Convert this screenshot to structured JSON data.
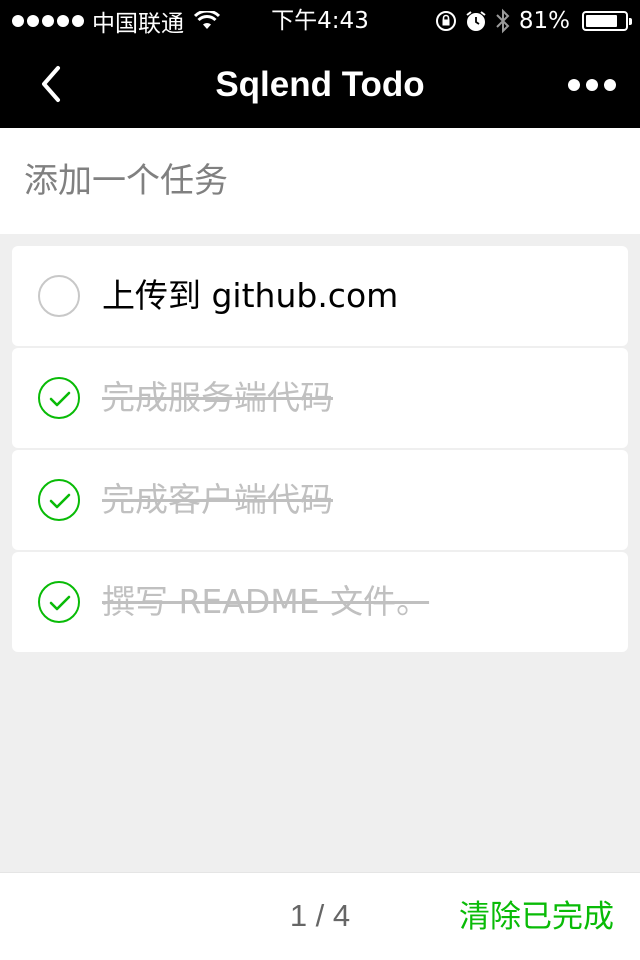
{
  "status_bar": {
    "carrier": "中国联通",
    "time": "下午4:43",
    "battery": "81%",
    "battery_level": 0.81,
    "icons": [
      "signal-dots-icon",
      "wifi-icon",
      "rotation-lock-icon",
      "alarm-icon",
      "bluetooth-icon",
      "battery-icon"
    ]
  },
  "nav": {
    "title": "Sqlend Todo",
    "back_icon": "chevron-left-icon",
    "more_icon": "more-dots-icon"
  },
  "add_task": {
    "placeholder": "添加一个任务",
    "value": ""
  },
  "todos": [
    {
      "text": "上传到 github.com",
      "completed": false
    },
    {
      "text": "完成服务端代码",
      "completed": true
    },
    {
      "text": "完成客户端代码",
      "completed": true
    },
    {
      "text": "撰写 README 文件。",
      "completed": true
    }
  ],
  "footer": {
    "counter": "1 / 4",
    "clear_label": "清除已完成"
  },
  "colors": {
    "accent_green": "#09bb07",
    "bar_background": "#000000",
    "page_background": "#efefef"
  }
}
